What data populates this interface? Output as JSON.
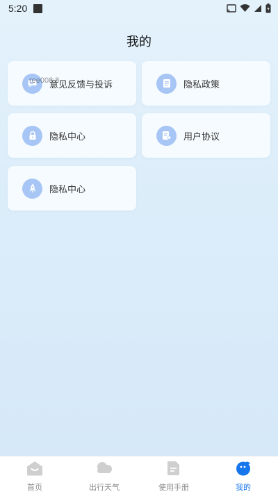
{
  "status_bar": {
    "time": "5:20",
    "icons": [
      "notification-icon",
      "cast-icon",
      "wifi-icon",
      "signal-icon",
      "battery-icon"
    ]
  },
  "page": {
    "title": "我的"
  },
  "cards": [
    {
      "label": "意见反馈与投诉",
      "icon": "feedback-icon",
      "overlay_text": "ree008 8"
    },
    {
      "label": "隐私政策",
      "icon": "document-icon"
    },
    {
      "label": "隐私中心",
      "icon": "lock-icon"
    },
    {
      "label": "用户协议",
      "icon": "agreement-icon"
    },
    {
      "label": "隐私中心",
      "icon": "rocket-icon"
    }
  ],
  "bottom_nav": {
    "items": [
      {
        "label": "首页",
        "icon": "home-icon",
        "active": false
      },
      {
        "label": "出行天气",
        "icon": "cloud-icon",
        "active": false
      },
      {
        "label": "使用手册",
        "icon": "manual-icon",
        "active": false
      },
      {
        "label": "我的",
        "icon": "profile-icon",
        "active": true
      }
    ]
  },
  "colors": {
    "accent": "#1776ec",
    "icon_circle": "#a7c6f5",
    "inactive_nav": "#cfcfcf"
  }
}
